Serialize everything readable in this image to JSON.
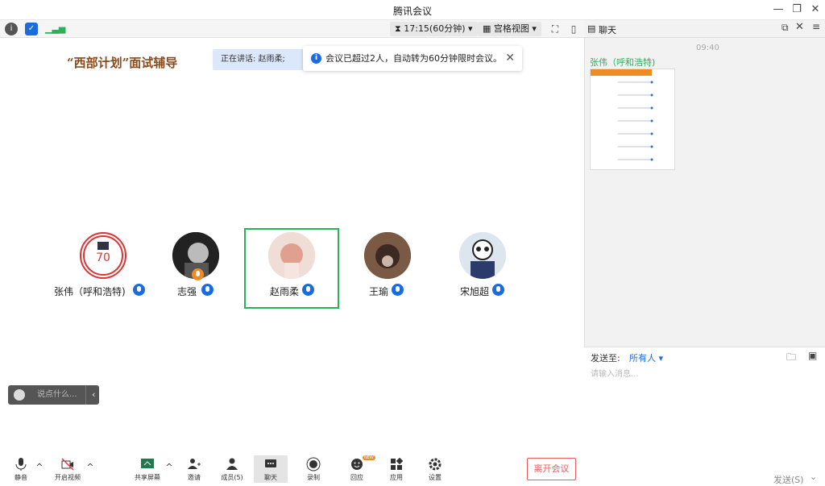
{
  "window": {
    "title": "腾讯会议"
  },
  "toolbar": {
    "timer": "17:15(60分钟)",
    "view_mode": "宫格视图"
  },
  "stage": {
    "meeting_title": "“西部计划”面试辅导",
    "speaking_label": "正在讲话: 赵雨柔;",
    "notice": "会议已超过2人，自动转为60分钟限时会议。"
  },
  "participants": [
    {
      "name": "张伟（呼和浩特)",
      "avatar": "logo-avatar"
    },
    {
      "name": "志强",
      "avatar": "portrait-avatar"
    },
    {
      "name": "赵雨柔",
      "avatar": "cartoon-avatar",
      "active": true
    },
    {
      "name": "王瑜",
      "avatar": "dog-avatar"
    },
    {
      "name": "宋旭超",
      "avatar": "panda-avatar"
    }
  ],
  "chat_input": {
    "placeholder": "说点什么..."
  },
  "bottom_bar": {
    "mute": "静音",
    "video": "开启视频",
    "share": "共享屏幕",
    "invite": "邀请",
    "members": "成员(5)",
    "chat": "聊天",
    "record": "录制",
    "react": "回应",
    "react_badge": "NEW",
    "apps": "应用",
    "settings": "设置",
    "leave": "离开会议"
  },
  "side_panel": {
    "title": "聊天",
    "message_time": "09:40",
    "message_sender": "张伟（呼和浩特)",
    "send_to_label": "发送至:",
    "send_to_value": "所有人",
    "input_placeholder": "请输入消息...",
    "send_label": "发送(S)"
  },
  "colors": {
    "accent_blue": "#1a6be0",
    "active_green": "#2bb05c",
    "leave_red": "#e95a5a",
    "title_brown": "#8a4a1c"
  }
}
